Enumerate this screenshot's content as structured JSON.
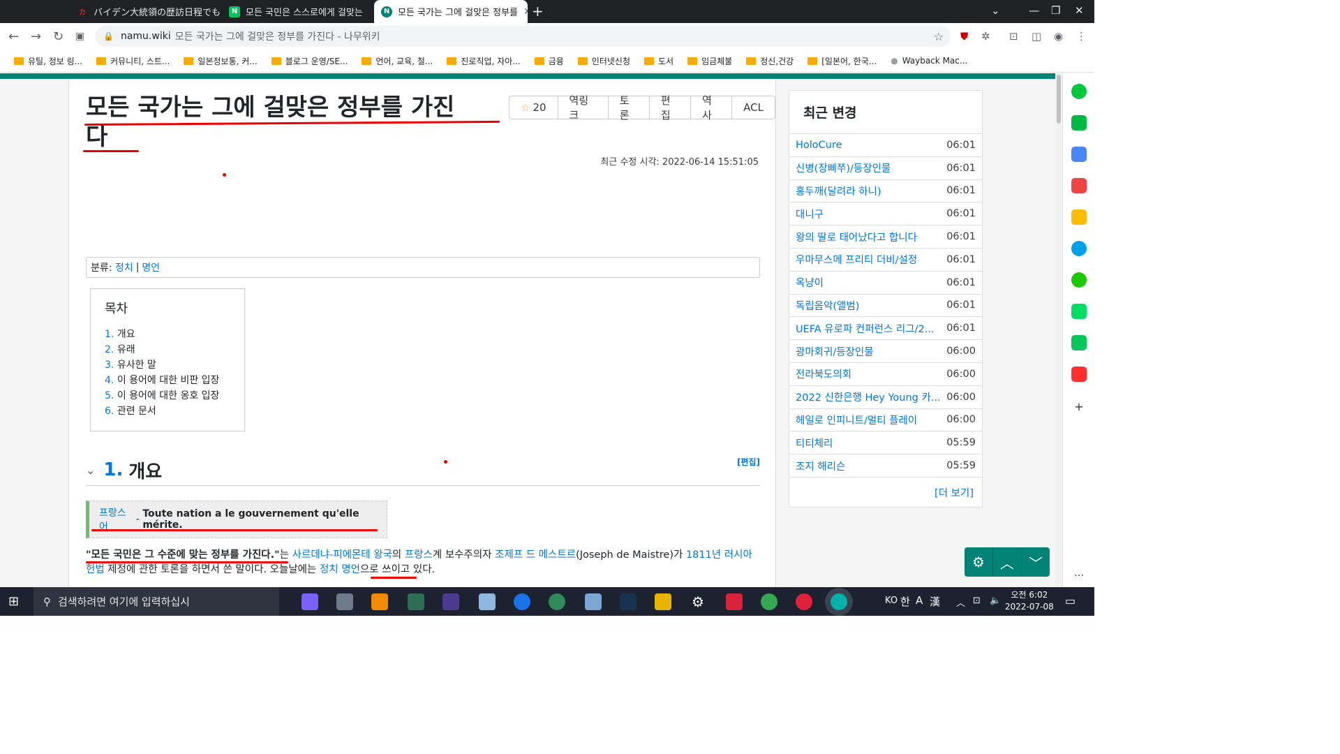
{
  "browser": {
    "tabs": [
      {
        "title": "バイデン大統領の歴訪日程でも日",
        "icon": "namu-icon",
        "color": "#c4302b"
      },
      {
        "title": "모든 국민은 스스로에게 걸맞는",
        "icon": "naver-icon",
        "color": "#03c75a"
      },
      {
        "title": "모든 국가는 그에 걸맞은 정부를",
        "icon": "namuwiki-icon",
        "color": "#008275"
      }
    ],
    "url_domain": "namu.wiki",
    "url_rest": "모든 국가는 그에 걸맞은 정부를 가진다 - 나무위키"
  },
  "bookmarks": [
    "유틸, 정보 링...",
    "커뮤니티, 스트...",
    "일본정보통, 커...",
    "블로그 운영/SE...",
    "언어, 교육, 철...",
    "진로직업, 자아...",
    "금융",
    "인터넷신청",
    "도서",
    "임금체불",
    "정신,건강",
    "[일본어, 한국...",
    "Wayback Mac..."
  ],
  "article": {
    "title_line1": "모든 국가는 그에 걸맞은 정부를 가진",
    "title_line2": "다",
    "star_count": "20",
    "toolbar": [
      "역링크",
      "토론",
      "편집",
      "역사",
      "ACL"
    ],
    "modified": "최근 수정 시각: 2022-06-14 15:51:05",
    "category_label": "분류:",
    "categories": [
      "정치",
      "명언"
    ],
    "toc_heading": "목차",
    "toc": [
      {
        "num": "1.",
        "label": "개요"
      },
      {
        "num": "2.",
        "label": "유래"
      },
      {
        "num": "3.",
        "label": "유사한 말"
      },
      {
        "num": "4.",
        "label": "이 용어에 대한 비판 입장"
      },
      {
        "num": "5.",
        "label": "이 용어에 대한 옹호 입장"
      },
      {
        "num": "6.",
        "label": "관련 문서"
      }
    ],
    "section_num": "1.",
    "section_title": "개요",
    "section_edit": "[편집]",
    "quote_lang": "프랑스어",
    "quote_sep": " - ",
    "quote_text": "Toute nation a le gouvernement qu'elle mérite.",
    "para": {
      "bold": "\"모든 국민은 그 수준에 맞는 정부를 가진다.\"",
      "t1": "는 ",
      "l1": "사르데냐-피에몬테 왕국",
      "t2": "의 ",
      "l2": "프랑스",
      "t3": "계 보수주의자 ",
      "l3": "조제프 드 메스트르",
      "t4": "(Joseph de Maistre)가 ",
      "l4": "1811년",
      "l5": "러시아 헌법",
      "t5": " 제정에 관한 토론을 하면서 쓴 말이다. 오늘날에는 ",
      "l6": "정치 명언",
      "t6": "으로 쓰이고 있다."
    }
  },
  "sidebar": {
    "heading": "최근 변경",
    "items": [
      {
        "title": "HoloCure",
        "time": "06:01"
      },
      {
        "title": "신병(장삐쭈)/등장인물",
        "time": "06:01"
      },
      {
        "title": "홍두깨(달려라 하니)",
        "time": "06:01"
      },
      {
        "title": "대니구",
        "time": "06:01"
      },
      {
        "title": "왕의 딸로 태어났다고 합니다",
        "time": "06:01"
      },
      {
        "title": "우마무스메 프리티 더비/설정",
        "time": "06:01"
      },
      {
        "title": "옥냥이",
        "time": "06:01"
      },
      {
        "title": "독립음악(앨범)",
        "time": "06:01"
      },
      {
        "title": "UEFA 유로파 컨퍼런스 리그/2...",
        "time": "06:01"
      },
      {
        "title": "광마회귀/등장인물",
        "time": "06:00"
      },
      {
        "title": "전라북도의회",
        "time": "06:00"
      },
      {
        "title": "2022 신한은행 Hey Young 카...",
        "time": "06:00"
      },
      {
        "title": "헤일로 인피니트/멀티 플레이",
        "time": "06:00"
      },
      {
        "title": "티티체리",
        "time": "05:59"
      },
      {
        "title": "조지 해리슨",
        "time": "05:59"
      }
    ],
    "more": "[더 보기]"
  },
  "taskbar": {
    "search_placeholder": "검색하려면 여기에 입력하십시",
    "ime": [
      "KO",
      "한",
      "A",
      "漢"
    ],
    "time": "오전 6:02",
    "date": "2022-07-08"
  }
}
